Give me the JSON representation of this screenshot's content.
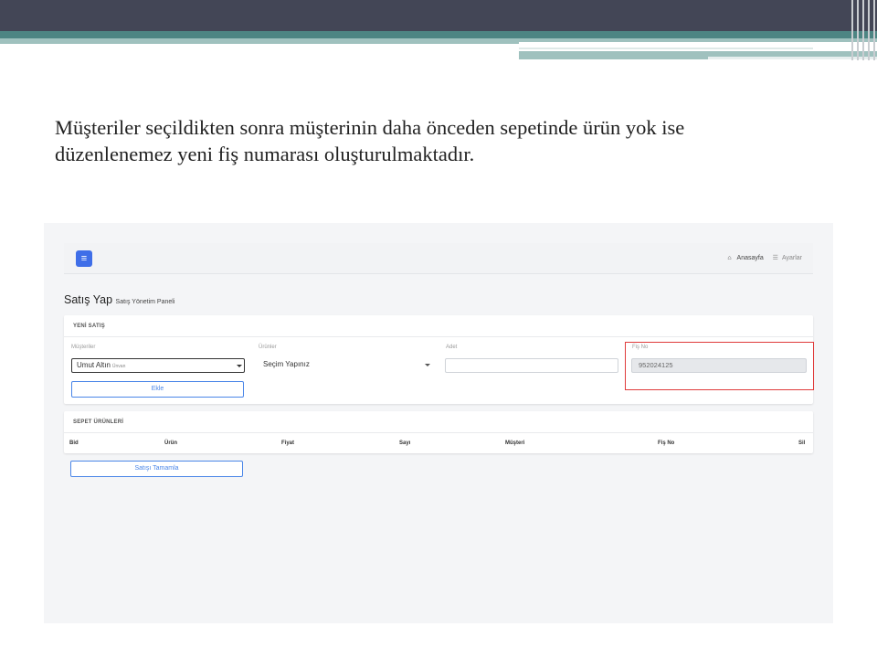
{
  "slide": {
    "caption_line1": "Müşteriler seçildikten sonra müşterinin daha önceden sepetinde ürün yok ise",
    "caption_line2": "düzenlenemez yeni fiş numarası oluşturulmaktadır."
  },
  "navbar": {
    "menu_icon": "hamburger-icon",
    "home_icon": "home-icon",
    "home_label": "Anasayfa",
    "settings_icon": "list-icon",
    "settings_label": "Ayarlar"
  },
  "page": {
    "title": "Satış Yap",
    "subtitle": "Satış Yönetim Paneli"
  },
  "new_sale": {
    "header": "YENİ SATIŞ",
    "customer_label": "Müşteriler",
    "customer_value": "Umut Altın",
    "customer_value_suffix": "Ünvan",
    "product_label": "Ürünler",
    "product_value": "Seçim Yapınız",
    "quantity_label": "Adet",
    "quantity_value": "",
    "receipt_label": "Fiş No",
    "receipt_value": "952024125",
    "add_button": "Ekle"
  },
  "cart": {
    "header": "SEPET ÜRÜNLERİ",
    "columns": [
      "Bid",
      "Ürün",
      "Fiyat",
      "Sayı",
      "Müşteri",
      "Fiş No",
      "Sil"
    ]
  },
  "complete_button": "Satışı Tamamla",
  "colors": {
    "accent": "#3f6ee8",
    "button_outline": "#4a86e8",
    "highlight": "#e03b3b"
  }
}
